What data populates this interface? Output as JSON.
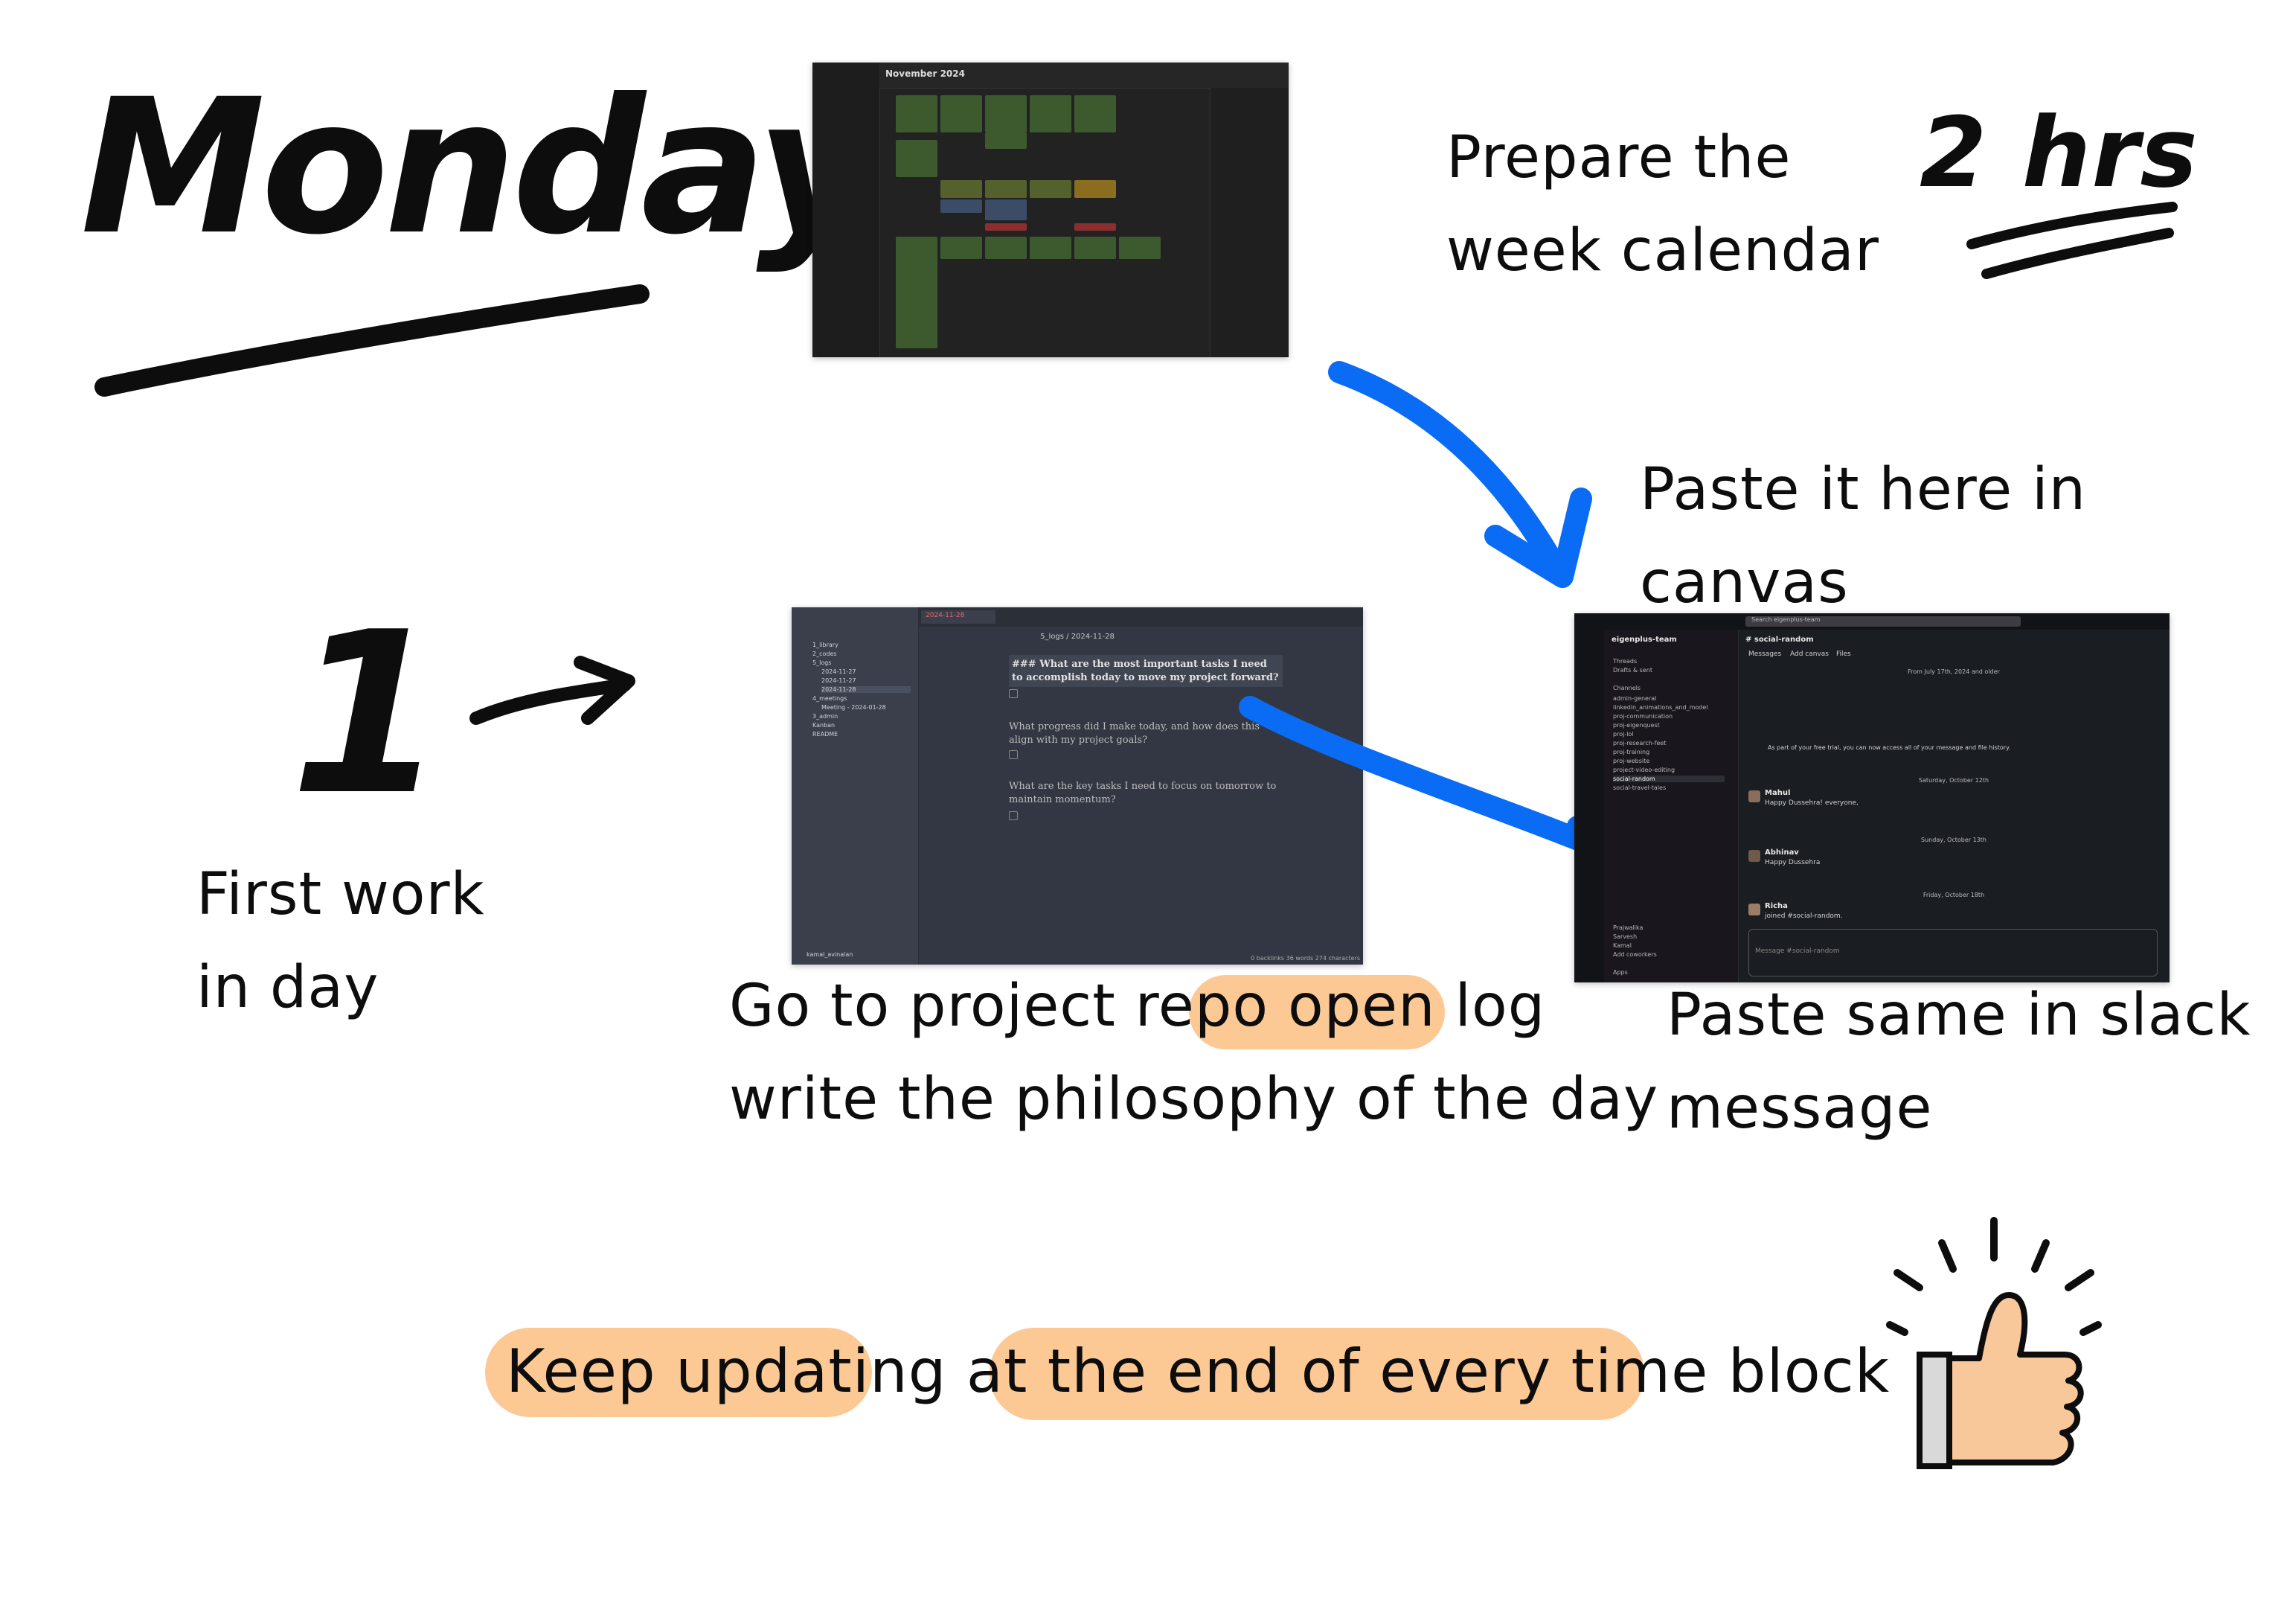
{
  "title": "Monday",
  "duration": "2 hrs",
  "step_number": "1",
  "notes": {
    "prepare_line1": "Prepare the",
    "prepare_line2": "week calendar",
    "paste_canvas": "Paste it here in canvas",
    "first_work_line1": "First work",
    "first_work_line2": "in day",
    "repo_line1_a": "Go to project repo ",
    "repo_line1_b": "open log",
    "repo_line2": "write the philosophy of the day",
    "slack_line1": "Paste same in slack",
    "slack_line2": "message",
    "footer_a": "Keep updating",
    "footer_b": " at ",
    "footer_c": "the end of every time block"
  },
  "calendar_shot": {
    "month": "November 2024"
  },
  "obsidian_shot": {
    "tab": "2024-11-28",
    "breadcrumb": "5_logs / 2024-11-28",
    "questions": [
      "### What are the most important tasks I need to accomplish today to move my project forward?",
      "What progress did I make today, and how does this align with my project goals?",
      "What are the key tasks I need to focus on tomorrow to maintain momentum?"
    ],
    "tree": [
      "1_library",
      "2_codes",
      "5_logs",
      "2024-11-27",
      "2024-11-27",
      "2024-11-28",
      "4_meetings",
      "Meeting - 2024-01-28",
      "3_admin",
      "Kanban",
      "README"
    ],
    "footer_user": "kamal_avinalan",
    "status": "0 backlinks   36 words   274 characters"
  },
  "slack_shot": {
    "workspace": "eigenplus-team",
    "search": "Search eigenplus-team",
    "channel": "# social-random",
    "tabs": [
      "Messages",
      "Add canvas",
      "Files"
    ],
    "sidebar": [
      "Threads",
      "Drafts & sent",
      "Channels",
      "admin-general",
      "linkedin_animations_and_model",
      "proj-communication",
      "proj-eigenquest",
      "proj-lol",
      "proj-research-feet",
      "proj-training",
      "proj-website",
      "project-video-editing",
      "social-random",
      "social-travel-tales"
    ],
    "dms": [
      "Prajwalika",
      "Sarvesh",
      "Kamal",
      "Add coworkers",
      "Apps"
    ],
    "dates": [
      "From July 17th, 2024 and older",
      "Saturday, October 12th",
      "Sunday, October 13th",
      "Friday, October 18th"
    ],
    "messages": [
      {
        "author": "Mahul",
        "text": "Happy Dussehra! everyone,"
      },
      {
        "author": "Abhinav",
        "text": "Happy Dussehra"
      },
      {
        "author": "Richa",
        "text": "joined #social-random."
      }
    ],
    "trial_notice": "As part of your free trial, you can now access all of your message and file history.",
    "input_placeholder": "Message #social-random"
  },
  "colors": {
    "highlight": "#fcc995",
    "arrow_blue": "#0a6cf5",
    "ink": "#0d0d0d",
    "thumb_fill": "#f8c89b"
  }
}
